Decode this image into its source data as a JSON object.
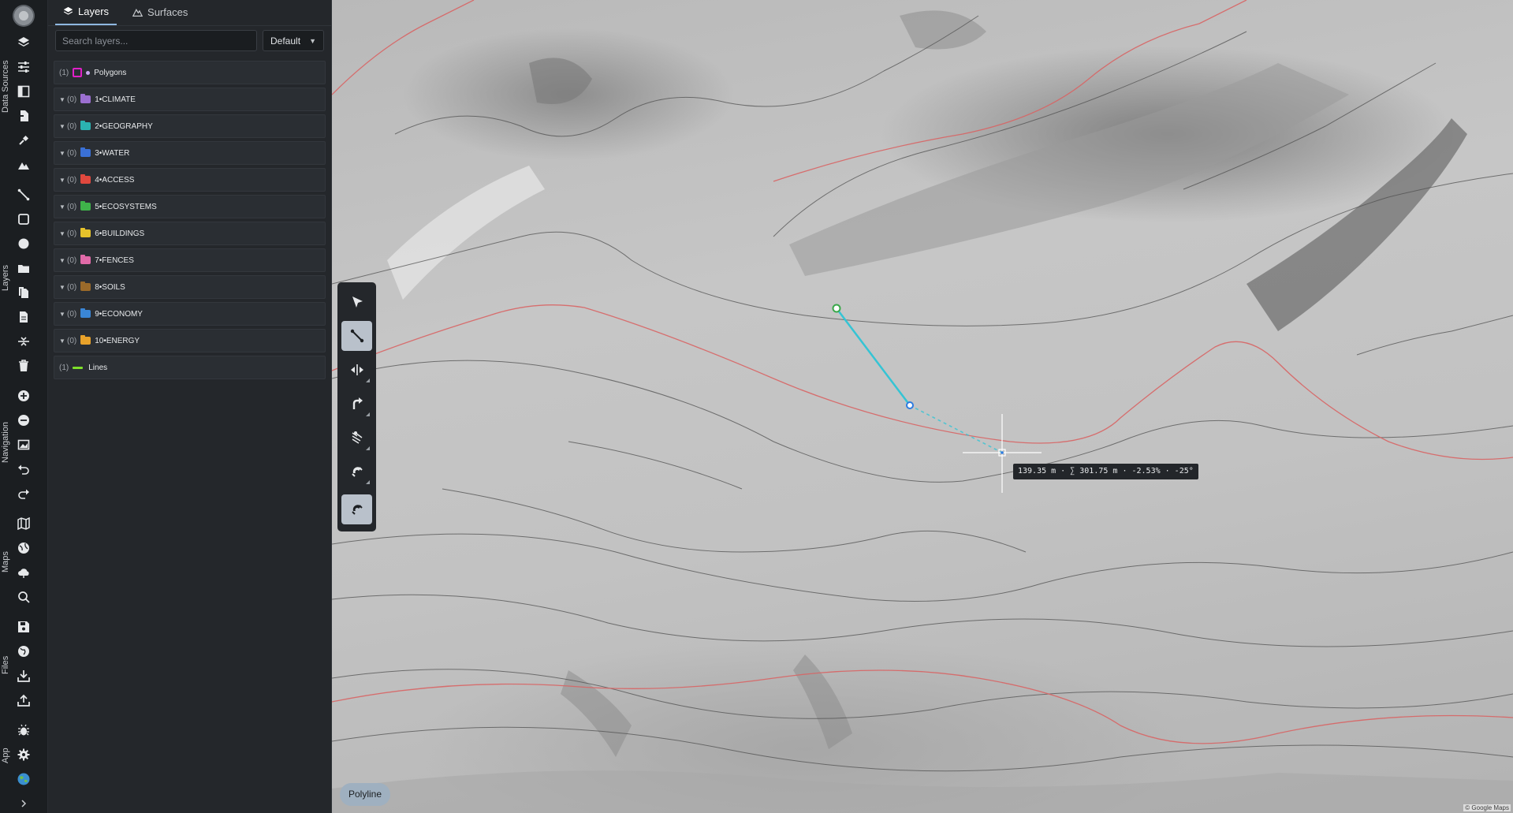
{
  "rail": {
    "sections": [
      "Data Sources",
      "Layers",
      "Navigation",
      "Maps",
      "Files",
      "App"
    ],
    "expand_icon": "chevron-right-icon"
  },
  "panel": {
    "tabs": [
      {
        "label": "Layers",
        "icon": "layers-icon",
        "active": true
      },
      {
        "label": "Surfaces",
        "icon": "mountain-icon",
        "active": false
      }
    ],
    "search": {
      "placeholder": "Search layers...",
      "value": ""
    },
    "preset": {
      "selected": "Default"
    },
    "layers": [
      {
        "type": "polygons",
        "count": "(1)",
        "name": "Polygons",
        "color": "#e020c8",
        "expandable": false
      },
      {
        "type": "folder",
        "count": "(0)",
        "name": "1•CLIMATE",
        "color": "#9b6fd0",
        "expandable": true
      },
      {
        "type": "folder",
        "count": "(0)",
        "name": "2•GEOGRAPHY",
        "color": "#2bb3b1",
        "expandable": true
      },
      {
        "type": "folder",
        "count": "(0)",
        "name": "3•WATER",
        "color": "#3a70d6",
        "expandable": true
      },
      {
        "type": "folder",
        "count": "(0)",
        "name": "4•ACCESS",
        "color": "#e0483e",
        "expandable": true
      },
      {
        "type": "folder",
        "count": "(0)",
        "name": "5•ECOSYSTEMS",
        "color": "#3fb34a",
        "expandable": true
      },
      {
        "type": "folder",
        "count": "(0)",
        "name": "6•BUILDINGS",
        "color": "#e6c22b",
        "expandable": true
      },
      {
        "type": "folder",
        "count": "(0)",
        "name": "7•FENCES",
        "color": "#e06aa8",
        "expandable": true
      },
      {
        "type": "folder",
        "count": "(0)",
        "name": "8•SOILS",
        "color": "#9a6a2a",
        "expandable": true
      },
      {
        "type": "folder",
        "count": "(0)",
        "name": "9•ECONOMY",
        "color": "#3a86d6",
        "expandable": true
      },
      {
        "type": "folder",
        "count": "(0)",
        "name": "10•ENERGY",
        "color": "#e8a22a",
        "expandable": true
      },
      {
        "type": "lines",
        "count": "(1)",
        "name": "Lines",
        "color": "#7ee02a",
        "expandable": false
      }
    ]
  },
  "map": {
    "tooltip": "139.35 m · ∑ 301.75 m · -2.53% · -25°",
    "mode": "Polyline",
    "attribution": "© Google Maps",
    "draw_color": "#35c4d4",
    "contour_color": "#505050",
    "highlight_contour_color": "#d86464"
  }
}
